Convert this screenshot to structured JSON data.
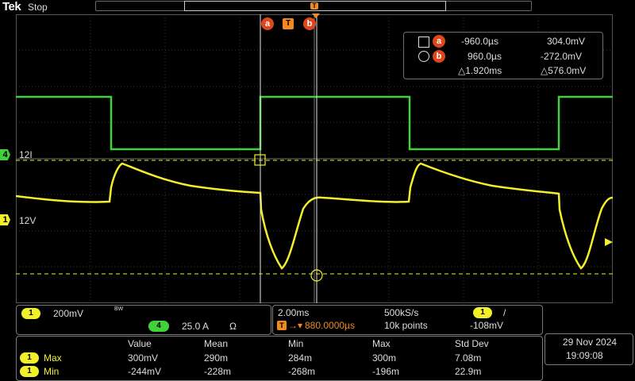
{
  "topbar": {
    "brand": "Tek",
    "acq_state": "Stop",
    "trigger_mark": "T"
  },
  "markers": {
    "cursor_a": "a",
    "trigger": "T",
    "cursor_b": "b"
  },
  "cursor_readout": {
    "a_time": "-960.0µs",
    "a_value": "304.0mV",
    "b_time": "960.0µs",
    "b_value": "-272.0mV",
    "delta_time": "△1.920ms",
    "delta_value": "△576.0mV"
  },
  "channels": {
    "ch1": {
      "number": "1",
      "label": "12V",
      "color": "#f3ef2a"
    },
    "ch4": {
      "number": "4",
      "label": "12I",
      "color": "#41d13b"
    }
  },
  "vertical_panel": {
    "ch1_scale": "200mV",
    "ch1_bw": "BW",
    "ch4_scale": "25.0 A",
    "ch4_coupling": "Ω"
  },
  "horizontal_panel": {
    "timebase": "2.00ms",
    "sample_rate": "500kS/s",
    "trigger_channel": "1",
    "trigger_slope": "/",
    "trigger_position": "880.0000µs",
    "record_length": "10k points",
    "trigger_level": "-108mV"
  },
  "measurements": {
    "headers": [
      "Value",
      "Mean",
      "Min",
      "Max",
      "Std Dev"
    ],
    "rows": [
      {
        "channel": "1",
        "name": "Max",
        "values": [
          "300mV",
          "290m",
          "284m",
          "300m",
          "7.08m"
        ]
      },
      {
        "channel": "1",
        "name": "Min",
        "values": [
          "-244mV",
          "-228m",
          "-268m",
          "-196m",
          "22.9m"
        ]
      }
    ]
  },
  "datetime": {
    "date": "29 Nov 2024",
    "time": "19:09:08"
  }
}
